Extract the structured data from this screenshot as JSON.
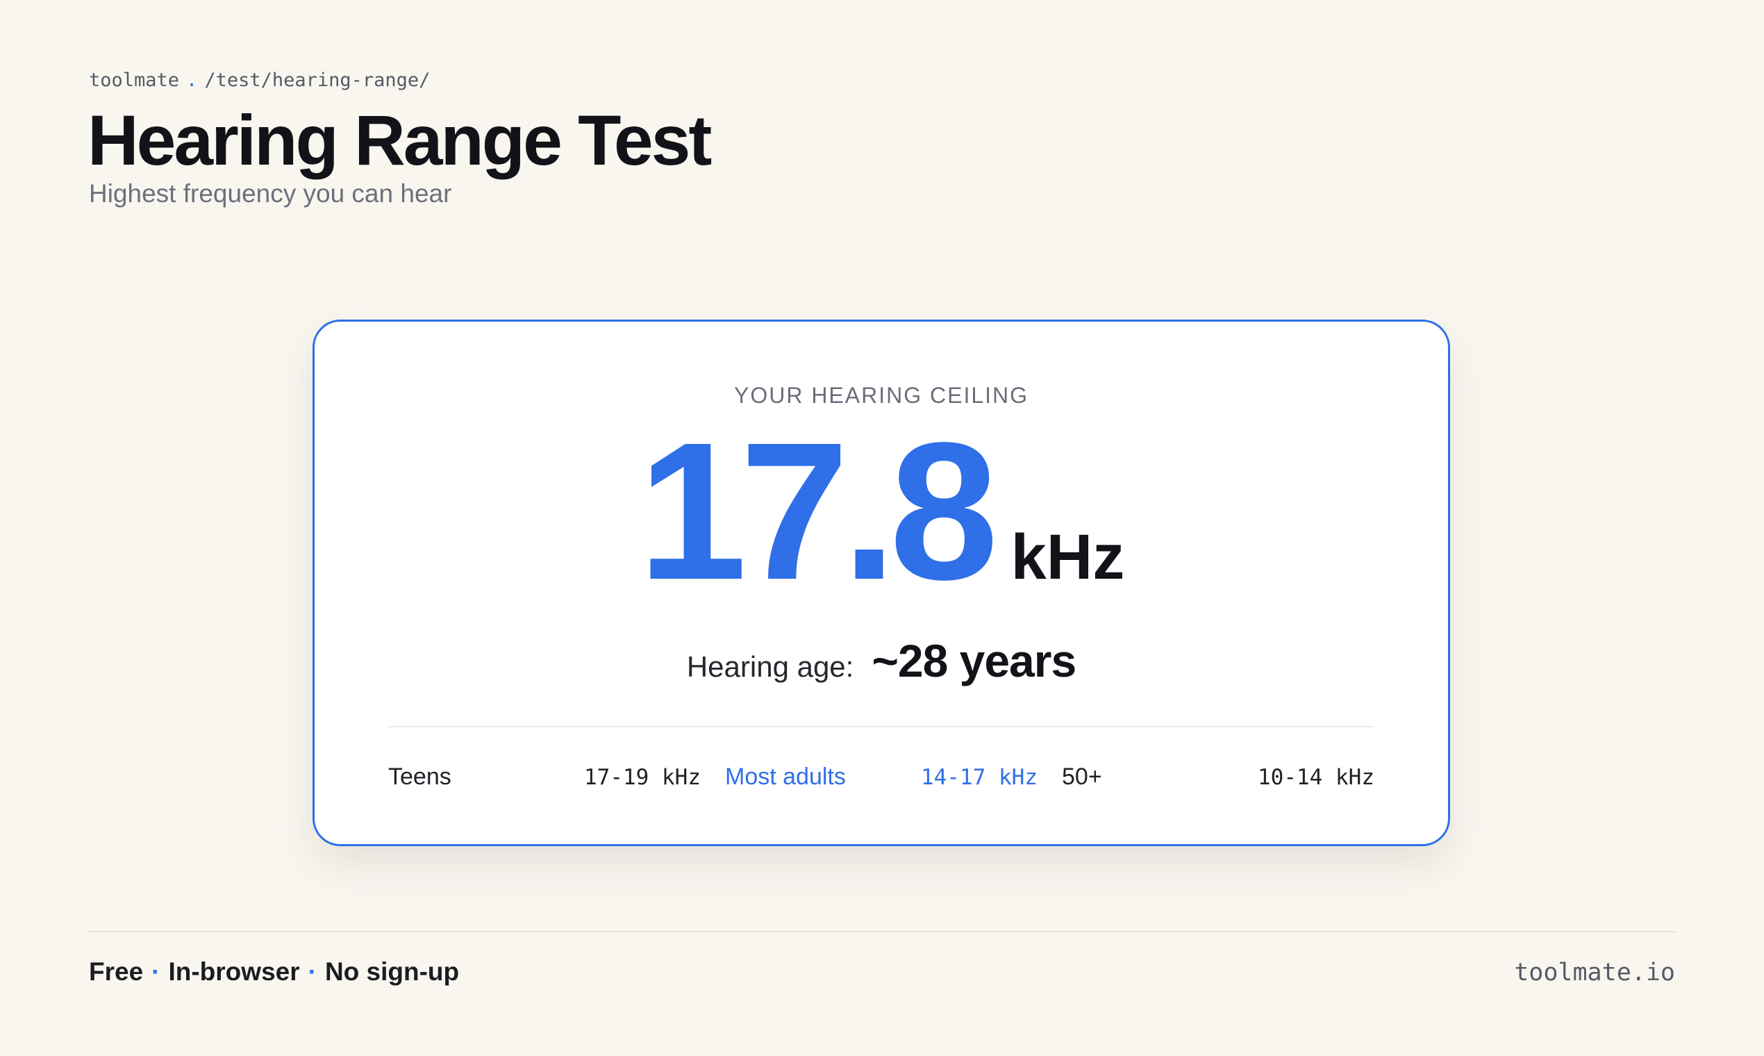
{
  "header": {
    "site": "toolmate",
    "separator": ".",
    "path": "/test/hearing-range/",
    "title": "Hearing Range Test",
    "subtitle": "Highest frequency you can hear"
  },
  "result": {
    "label": "YOUR HEARING CEILING",
    "value": "17.8",
    "unit": "kHz",
    "hearing_age_label": "Hearing age:",
    "hearing_age_value": "~28 years"
  },
  "ranges": [
    {
      "name": "Teens",
      "value": "17-19 kHz",
      "highlighted": false
    },
    {
      "name": "Most adults",
      "value": "14-17 kHz",
      "highlighted": true
    },
    {
      "name": "50+",
      "value": "10-14 kHz",
      "highlighted": false
    }
  ],
  "footer": {
    "tags": [
      "Free",
      "In-browser",
      "No sign-up"
    ],
    "tag_separator": "·",
    "domain": "toolmate.io"
  },
  "colors": {
    "accent": "#2f6fe8",
    "background": "#f8f6ef",
    "card": "#ffffff",
    "text": "#121318",
    "muted": "#6c707c"
  }
}
